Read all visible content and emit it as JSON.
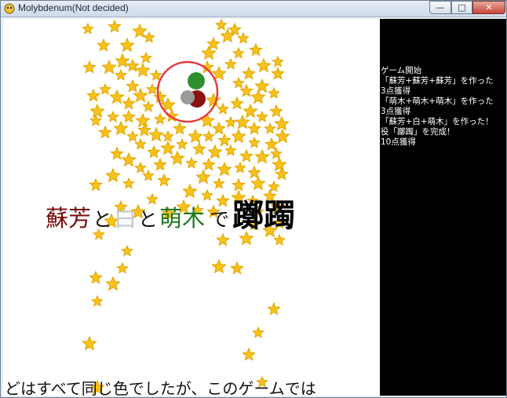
{
  "window": {
    "title": "Molybdenum(Not decided)",
    "buttons": {
      "minimize": "—",
      "maximize": "□",
      "close": "✕"
    }
  },
  "game": {
    "combo_title": [
      {
        "text": "蘇芳",
        "color": "#7a0a0a"
      },
      {
        "text": "と",
        "color": "#111111"
      },
      {
        "text": "白",
        "color": "#c9c9c9"
      },
      {
        "text": "と",
        "color": "#111111"
      },
      {
        "text": "萌木",
        "color": "#1f7a1f"
      },
      {
        "text": "で",
        "color": "#111111"
      },
      {
        "text": "躑躅",
        "color": "#000000"
      }
    ],
    "subtitle": "どはすべて同じ色でしたが、このゲームでは",
    "orb": {
      "ring_color": "#e33b3b",
      "petal_colors": [
        "#2f8f2f",
        "#8a1111",
        "#9a9a9a"
      ]
    },
    "star_color": "#f7c21b"
  },
  "log": {
    "lines": [
      "ゲーム開始",
      "「蘇芳+蘇芳+蘇芳」を作った",
      "3点獲得",
      "「萌木+萌木+萌木」を作った",
      "3点獲得",
      "「蘇芳+白+萌木」を作った！",
      "役「躑躅」を完成！",
      "10点獲得"
    ]
  }
}
